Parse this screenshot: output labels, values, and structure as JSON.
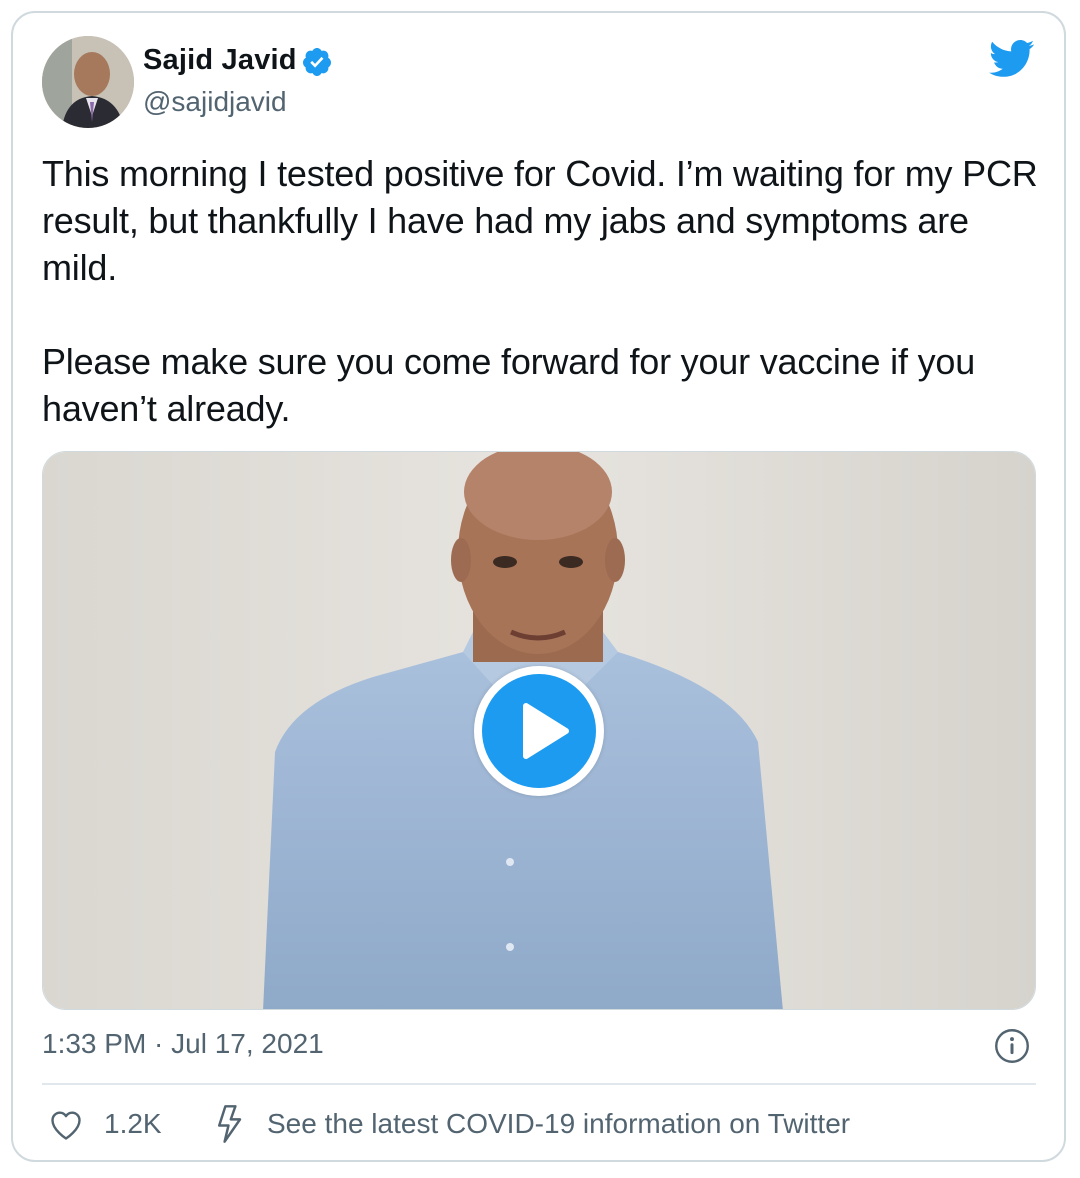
{
  "tweet": {
    "author_name": "Sajid Javid",
    "handle": "@sajidjavid",
    "text": "This morning I tested positive for Covid. I’m waiting for my PCR result, but thankfully I have had my jabs and symptoms are mild.\n\nPlease make sure you come forward for your vaccine if you haven’t already.",
    "timestamp": "1:33 PM · Jul 17, 2021",
    "like_count": "1.2K",
    "covid_link": "See the latest COVID-19 information on Twitter"
  },
  "icons": {
    "brand": "twitter-bird-icon",
    "verified": "verified-badge-icon",
    "play": "play-icon",
    "info": "info-icon",
    "like": "heart-icon",
    "covid": "lightning-bolt-icon"
  },
  "colors": {
    "twitter_blue": "#1d9bf0",
    "secondary_text": "#536471",
    "border": "#cfd9de"
  }
}
